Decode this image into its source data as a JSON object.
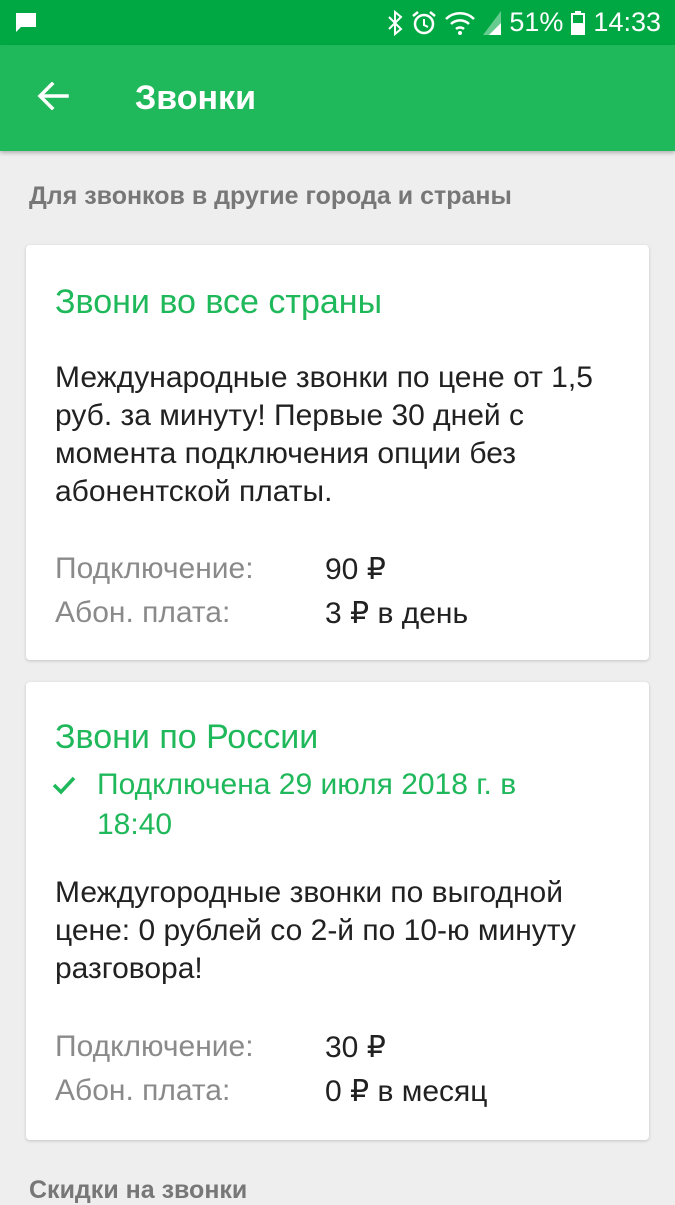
{
  "status_bar": {
    "battery_percent": "51%",
    "time": "14:33"
  },
  "app_bar": {
    "title": "Звонки"
  },
  "section1": {
    "header": "Для звонков в другие города и страны"
  },
  "card1": {
    "title": "Звони во все страны",
    "description": "Международные звонки по цене от 1,5 руб. за минуту! Первые 30 дней с момента подключения опции без абонентской платы.",
    "connect_label": "Подключение:",
    "connect_value": "90 ₽",
    "fee_label": "Абон. плата:",
    "fee_value": "3 ₽ в день"
  },
  "card2": {
    "title": "Звони по России",
    "status": "Подключена 29 июля 2018 г. в 18:40",
    "description": "Междугородные звонки по выгодной цене: 0  рублей со 2-й по 10-ю минуту разговора!",
    "connect_label": "Подключение:",
    "connect_value": "30 ₽",
    "fee_label": "Абон. плата:",
    "fee_value": "0 ₽ в месяц"
  },
  "section2": {
    "header": "Скидки на звонки"
  },
  "colors": {
    "accent": "#1fb85a",
    "status_bar": "#00a843",
    "background": "#eeeeee"
  }
}
